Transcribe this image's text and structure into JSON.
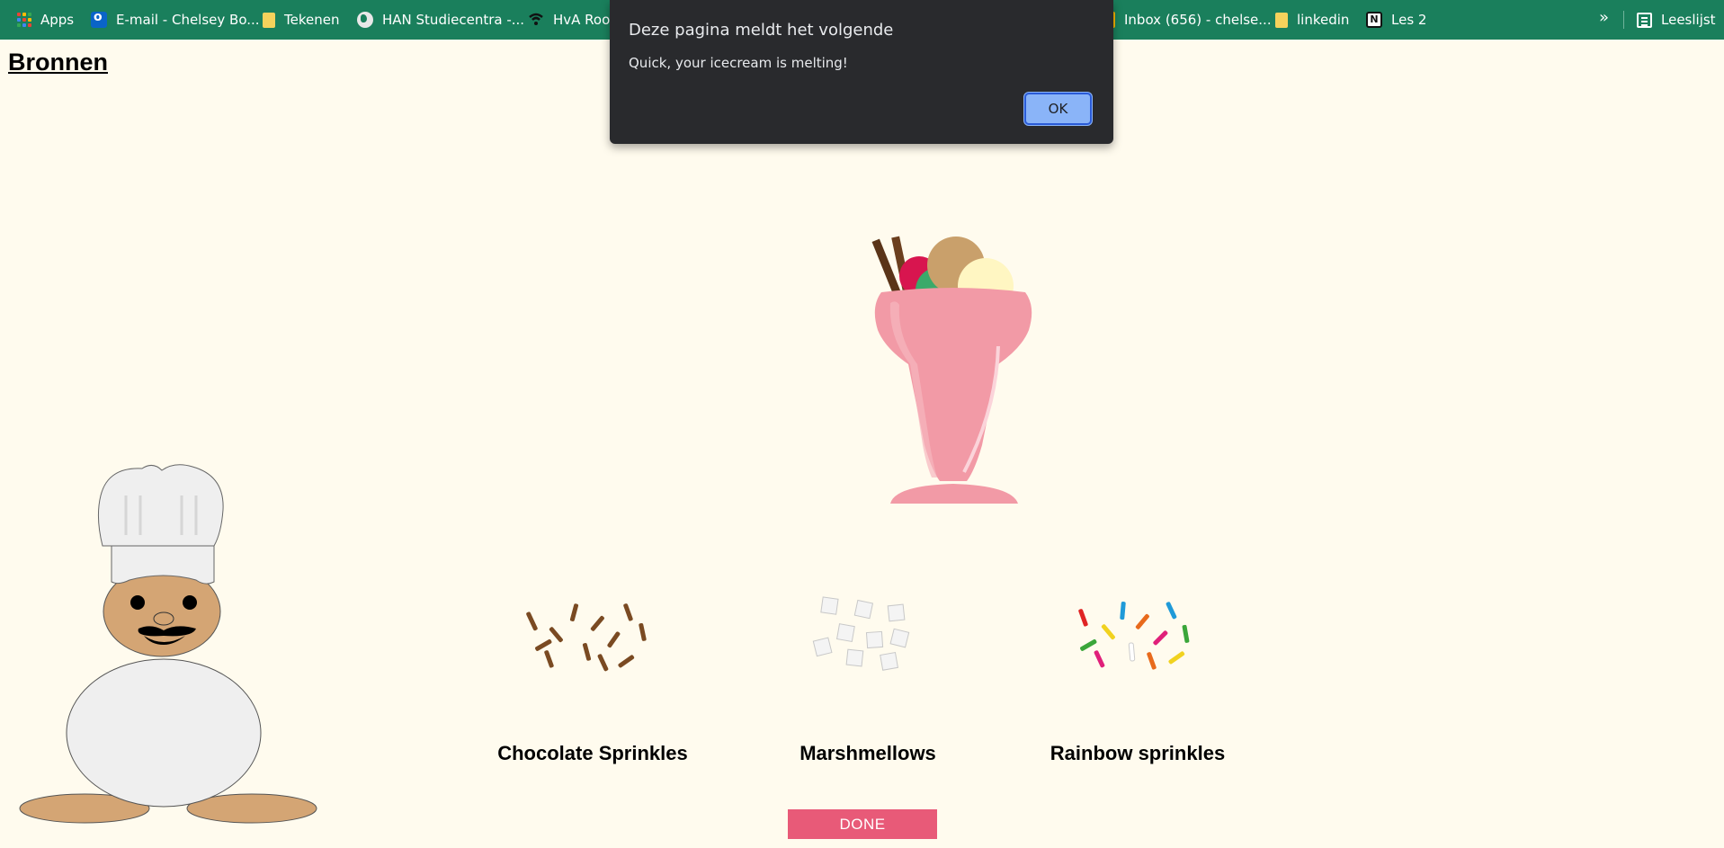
{
  "bookmarks": {
    "items": [
      {
        "label": "Apps",
        "icon": "apps-grid-icon"
      },
      {
        "label": "E-mail - Chelsey Bo...",
        "icon": "outlook-icon"
      },
      {
        "label": "Tekenen",
        "icon": "folder-icon"
      },
      {
        "label": "HAN Studiecentra -...",
        "icon": "globe-icon"
      },
      {
        "label": "HvA Roos",
        "icon": "hva-icon"
      },
      {
        "label": "Inbox (656) - chelse...",
        "icon": "gmail-icon"
      },
      {
        "label": "linkedin",
        "icon": "folder-icon"
      },
      {
        "label": "Les 2",
        "icon": "notion-icon"
      }
    ],
    "more": "»",
    "reading_list": "Leeslijst",
    "bar_color": "#1a7f5c"
  },
  "page": {
    "title": "Bronnen",
    "background": "#fffbee"
  },
  "alert": {
    "title": "Deze pagina meldt het volgende",
    "message": "Quick, your icecream is melting!",
    "ok_label": "OK"
  },
  "toppings": [
    {
      "label": "Chocolate Sprinkles",
      "icon": "chocolate-sprinkles-icon"
    },
    {
      "label": "Marshmellows",
      "icon": "marshmallows-icon"
    },
    {
      "label": "Rainbow sprinkles",
      "icon": "rainbow-sprinkles-icon"
    }
  ],
  "done_button": {
    "label": "DONE",
    "color": "#e85a78"
  },
  "colors": {
    "glass": "#f29aa6",
    "scoop_chocolate": "#c9a06b",
    "scoop_vanilla": "#fff6c2",
    "scoop_mint": "#3aaa6a",
    "scoop_strawberry": "#d8154f",
    "chef_skin": "#d4a574"
  }
}
